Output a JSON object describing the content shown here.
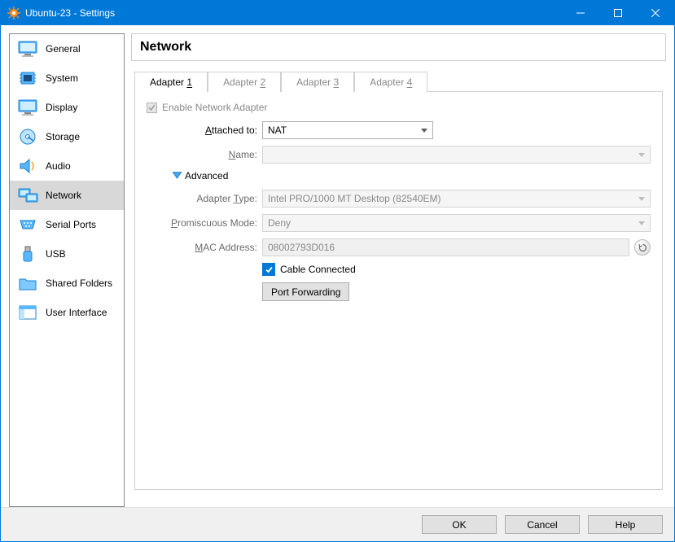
{
  "window": {
    "title": "Ubuntu-23 - Settings"
  },
  "sidebar": {
    "items": [
      {
        "label": "General"
      },
      {
        "label": "System"
      },
      {
        "label": "Display"
      },
      {
        "label": "Storage"
      },
      {
        "label": "Audio"
      },
      {
        "label": "Network"
      },
      {
        "label": "Serial Ports"
      },
      {
        "label": "USB"
      },
      {
        "label": "Shared Folders"
      },
      {
        "label": "User Interface"
      }
    ],
    "selected_index": 5
  },
  "page": {
    "title": "Network"
  },
  "tabs": [
    {
      "prefix": "Adapter ",
      "num": "1",
      "active": true
    },
    {
      "prefix": "Adapter ",
      "num": "2",
      "active": false
    },
    {
      "prefix": "Adapter ",
      "num": "3",
      "active": false
    },
    {
      "prefix": "Adapter ",
      "num": "4",
      "active": false
    }
  ],
  "adapter": {
    "enable_label": "Enable Network Adapter",
    "enable_checked": true,
    "attached_label_pre": "A",
    "attached_label_post": "ttached to:",
    "attached_value": "NAT",
    "name_label_pre": "N",
    "name_label_post": "ame:",
    "name_value": "",
    "advanced_label_pre": "A",
    "advanced_label_post": "dvanced",
    "type_label_pre": "Adapter ",
    "type_label_u": "T",
    "type_label_post": "ype:",
    "type_value": "Intel PRO/1000 MT Desktop (82540EM)",
    "promisc_label_pre": "P",
    "promisc_label_post": "romiscuous Mode:",
    "promisc_value": "Deny",
    "mac_label_pre": "M",
    "mac_label_post": "AC Address:",
    "mac_value": "08002793D016",
    "cable_label_pre": "C",
    "cable_label_post": "able Connected",
    "cable_checked": true,
    "pf_label_pre": "P",
    "pf_label_post": "ort Forwarding"
  },
  "footer": {
    "ok": "OK",
    "cancel": "Cancel",
    "help_pre": "H",
    "help_post": "elp"
  }
}
